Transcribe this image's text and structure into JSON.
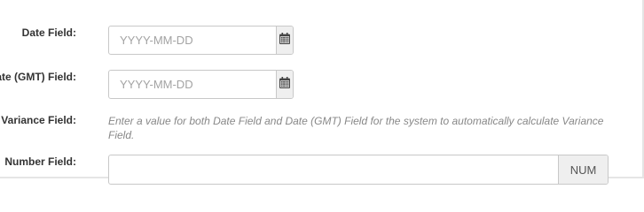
{
  "form": {
    "date_field": {
      "label": "Date Field:",
      "placeholder": "YYYY-MM-DD",
      "icon": "calendar-icon"
    },
    "date_gmt_field": {
      "label": "Date (GMT) Field:",
      "placeholder": "YYYY-MM-DD",
      "icon": "calendar-icon"
    },
    "variance_field": {
      "label": "Variance Field:",
      "help_text": "Enter a value for both Date Field and Date (GMT) Field for the system to automatically calculate Variance Field."
    },
    "number_field": {
      "label": "Number Field:",
      "value": "",
      "addon": "NUM"
    }
  }
}
